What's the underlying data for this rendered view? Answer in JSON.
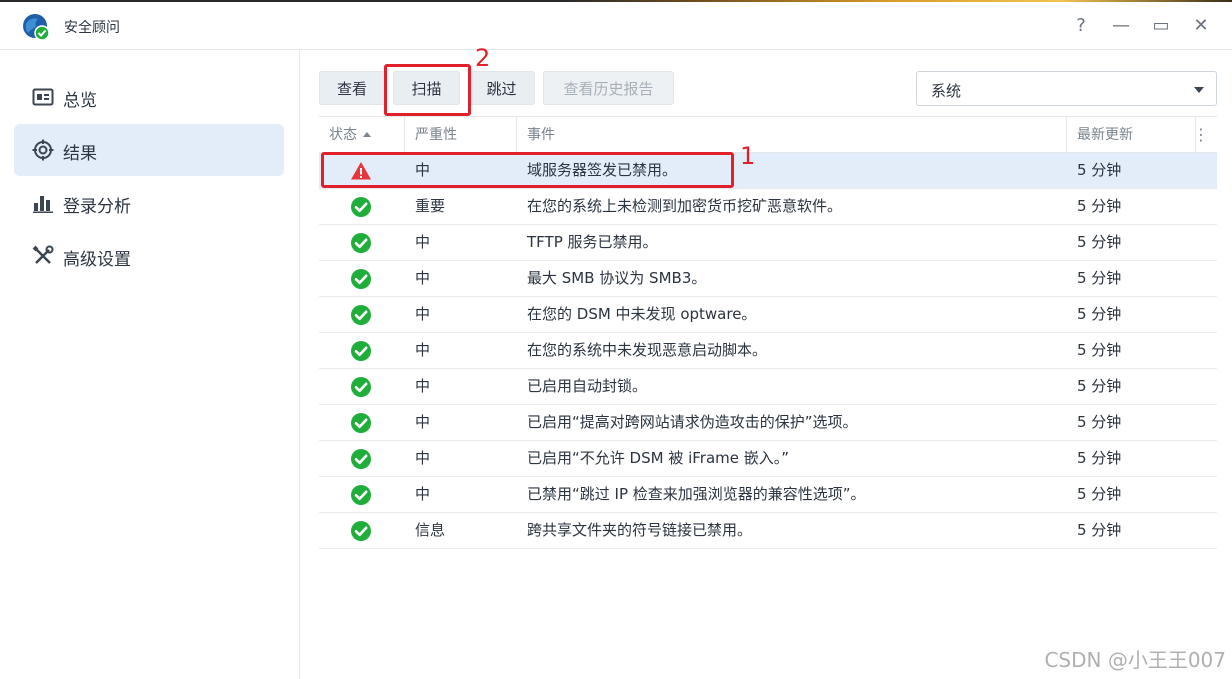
{
  "window": {
    "title": "安全顾问",
    "controls": {
      "help": "?",
      "minimize": "—",
      "maximize": "▭",
      "close": "✕"
    }
  },
  "sidebar": {
    "items": [
      {
        "label": "总览",
        "icon": "overview-icon",
        "active": false
      },
      {
        "label": "结果",
        "icon": "results-target-icon",
        "active": true
      },
      {
        "label": "登录分析",
        "icon": "bar-chart-icon",
        "active": false
      },
      {
        "label": "高级设置",
        "icon": "tools-icon",
        "active": false
      }
    ]
  },
  "toolbar": {
    "view_label": "查看",
    "scan_label": "扫描",
    "skip_label": "跳过",
    "history_label": "查看历史报告",
    "history_disabled": true
  },
  "filter": {
    "selected": "系统"
  },
  "table": {
    "headers": {
      "status": "状态",
      "severity": "严重性",
      "event": "事件",
      "updated": "最新更新"
    },
    "rows": [
      {
        "status": "warning",
        "severity": "中",
        "event": "域服务器签发已禁用。",
        "updated": "5 分钟"
      },
      {
        "status": "ok",
        "severity": "重要",
        "event": "在您的系统上未检测到加密货币挖矿恶意软件。",
        "updated": "5 分钟"
      },
      {
        "status": "ok",
        "severity": "中",
        "event": "TFTP 服务已禁用。",
        "updated": "5 分钟"
      },
      {
        "status": "ok",
        "severity": "中",
        "event": "最大 SMB 协议为 SMB3。",
        "updated": "5 分钟"
      },
      {
        "status": "ok",
        "severity": "中",
        "event": "在您的 DSM 中未发现 optware。",
        "updated": "5 分钟"
      },
      {
        "status": "ok",
        "severity": "中",
        "event": "在您的系统中未发现恶意启动脚本。",
        "updated": "5 分钟"
      },
      {
        "status": "ok",
        "severity": "中",
        "event": "已启用自动封锁。",
        "updated": "5 分钟"
      },
      {
        "status": "ok",
        "severity": "中",
        "event": "已启用“提高对跨网站请求伪造攻击的保护”选项。",
        "updated": "5 分钟"
      },
      {
        "status": "ok",
        "severity": "中",
        "event": "已启用“不允许 DSM 被 iFrame 嵌入。”",
        "updated": "5 分钟"
      },
      {
        "status": "ok",
        "severity": "中",
        "event": "已禁用“跳过 IP 检查来加强浏览器的兼容性选项”。",
        "updated": "5 分钟"
      },
      {
        "status": "ok",
        "severity": "信息",
        "event": "跨共享文件夹的符号链接已禁用。",
        "updated": "5 分钟"
      }
    ]
  },
  "annotations": [
    {
      "label": "1"
    },
    {
      "label": "2"
    }
  ],
  "colors": {
    "accent": "#e3edf9",
    "ok": "#1fae3a",
    "warning": "#e6353b",
    "annotation": "#e0202a"
  },
  "watermark": "CSDN @小王王007"
}
